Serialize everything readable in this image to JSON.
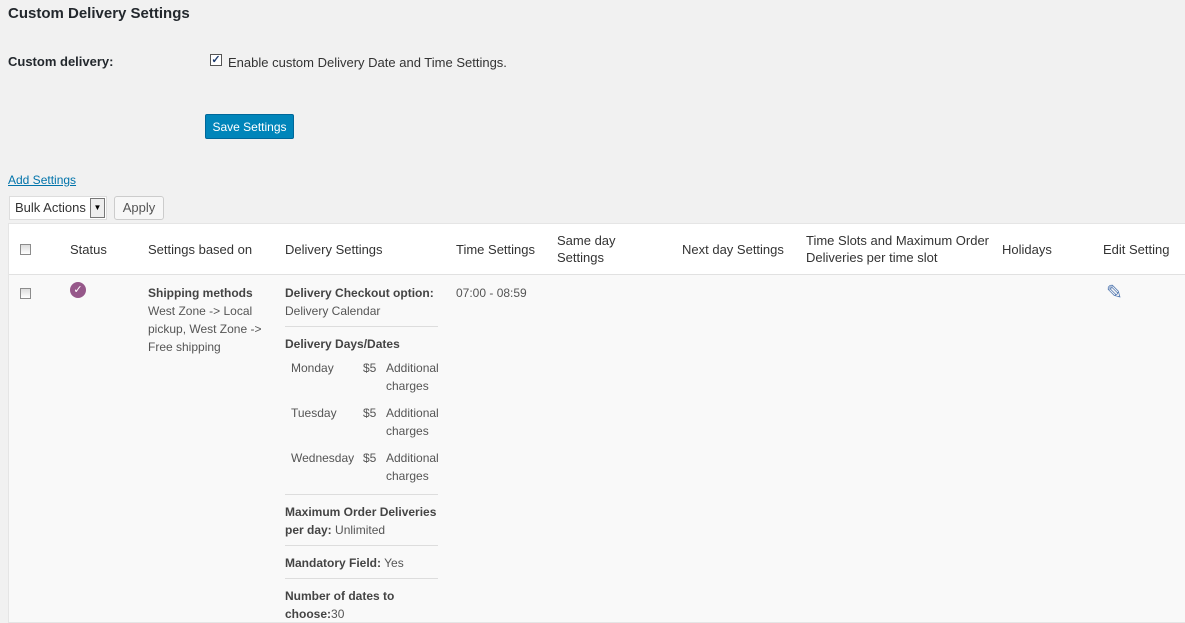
{
  "page_title": "Custom Delivery Settings",
  "custom_delivery": {
    "label": "Custom delivery:",
    "checkbox_label": "Enable custom Delivery Date and Time Settings.",
    "checked": true
  },
  "save_button": "Save Settings",
  "add_settings_link": "Add Settings",
  "bulk_actions": {
    "selected": "Bulk Actions",
    "apply": "Apply"
  },
  "columns": [
    "Status",
    "Settings based on",
    "Delivery Settings",
    "Time Settings",
    "Same day Settings",
    "Next day Settings",
    "Time Slots and Maximum Order Deliveries per time slot",
    "Holidays",
    "Edit Setting"
  ],
  "row": {
    "status": "enabled",
    "settings_based_on_title": "Shipping methods",
    "settings_based_on_value": "West Zone -> Local pickup, West Zone -> Free shipping",
    "delivery": {
      "checkout_label": "Delivery Checkout option:",
      "checkout_value": "Delivery Calendar",
      "days_title": "Delivery Days/Dates",
      "days": [
        {
          "day": "Monday",
          "price": "$5",
          "note": "Additional charges"
        },
        {
          "day": "Tuesday",
          "price": "$5",
          "note": "Additional charges"
        },
        {
          "day": "Wednesday",
          "price": "$5",
          "note": "Additional charges"
        }
      ],
      "max_label": "Maximum Order Deliveries per day:",
      "max_value": " Unlimited",
      "mandatory_label": "Mandatory Field:",
      "mandatory_value": " Yes",
      "dates_label": "Number of dates to choose:",
      "dates_value": "30"
    },
    "time_settings": "07:00 - 08:59"
  },
  "colors": {
    "primary": "#0085ba",
    "status": "#96588a",
    "link": "#0073aa"
  }
}
